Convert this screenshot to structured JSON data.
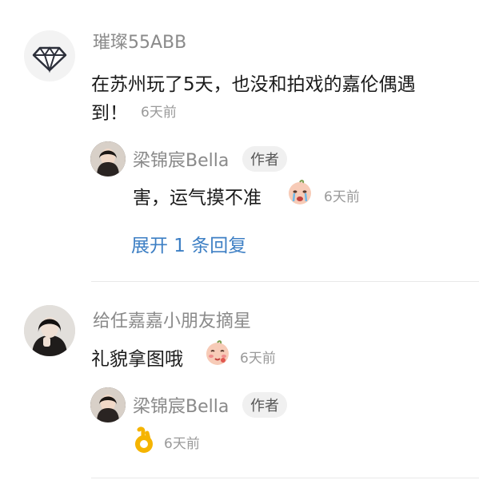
{
  "comments": [
    {
      "username": "璀璨55ABB",
      "text_line1": "在苏州玩了5天，也没和拍戏的嘉伦偶遇",
      "text_line2": "到！",
      "time": "6天前",
      "avatar_icon": "diamond-icon",
      "reply": {
        "username": "梁锦宸Bella",
        "badge": "作者",
        "text": "害，运气摸不准",
        "emoji": "crying-face-emoji",
        "time": "6天前"
      },
      "expand_label": "展开 1 条回复"
    },
    {
      "username": "给任嘉嘉小朋友摘星",
      "text": "礼貌拿图哦",
      "emoji": "blushing-face-emoji",
      "time": "6天前",
      "reply": {
        "username": "梁锦宸Bella",
        "badge": "作者",
        "emoji": "ok-hand-emoji",
        "time": "6天前"
      }
    }
  ],
  "colors": {
    "link": "#3d7fc4",
    "name": "#8a8a8a",
    "text": "#1a1a1a"
  }
}
